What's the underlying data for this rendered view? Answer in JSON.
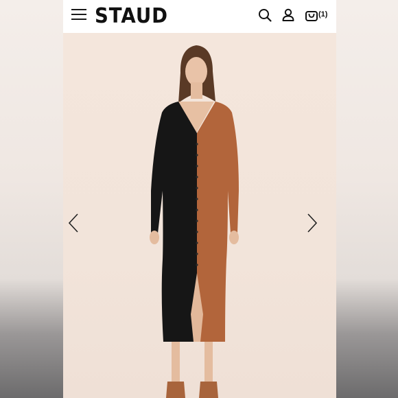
{
  "header": {
    "brand": "STAUD",
    "cart_count": "(1)"
  },
  "icons": {
    "menu": "hamburger-menu-icon",
    "search": "search-icon",
    "account": "user-icon",
    "cart": "shopping-bag-icon",
    "prev": "chevron-left-icon",
    "next": "chevron-right-icon"
  },
  "colors": {
    "dress_left": "#161616",
    "dress_right": "#b2653b",
    "background": "#f3e6dd"
  }
}
